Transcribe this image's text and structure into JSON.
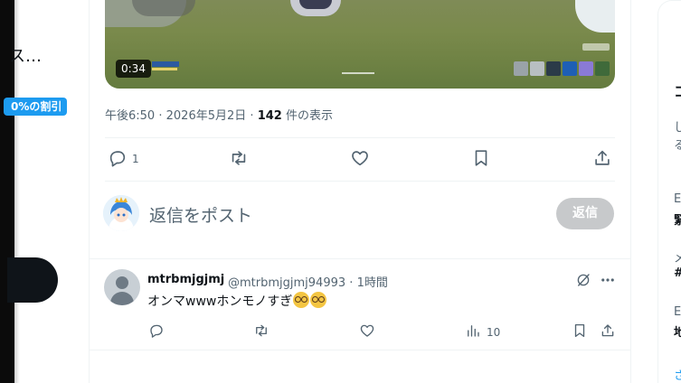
{
  "left_nav": {
    "truncated_text": "ス…",
    "badge": "0%の割引"
  },
  "video": {
    "duration": "0:34"
  },
  "tweet": {
    "time": "午後6:50",
    "date": "2026年5月2日",
    "separator": "·",
    "views_count": "142",
    "views_label": "件の表示",
    "reply_count": "1"
  },
  "reply_box": {
    "placeholder": "返信をポスト",
    "button_label": "返信"
  },
  "comment": {
    "display_name": "mtrbmjgjmj",
    "handle": "@mtrbmjgjmj94993",
    "time": "1時間",
    "separator": "·",
    "text": "オンマwwwホンモノすぎ",
    "emoji": "nerd-face",
    "views": "10"
  },
  "right_panel": {
    "lines": [
      "コ",
      "し",
      "る",
      "E",
      "緊",
      "メ",
      "#",
      "E",
      "地",
      "さ"
    ]
  }
}
